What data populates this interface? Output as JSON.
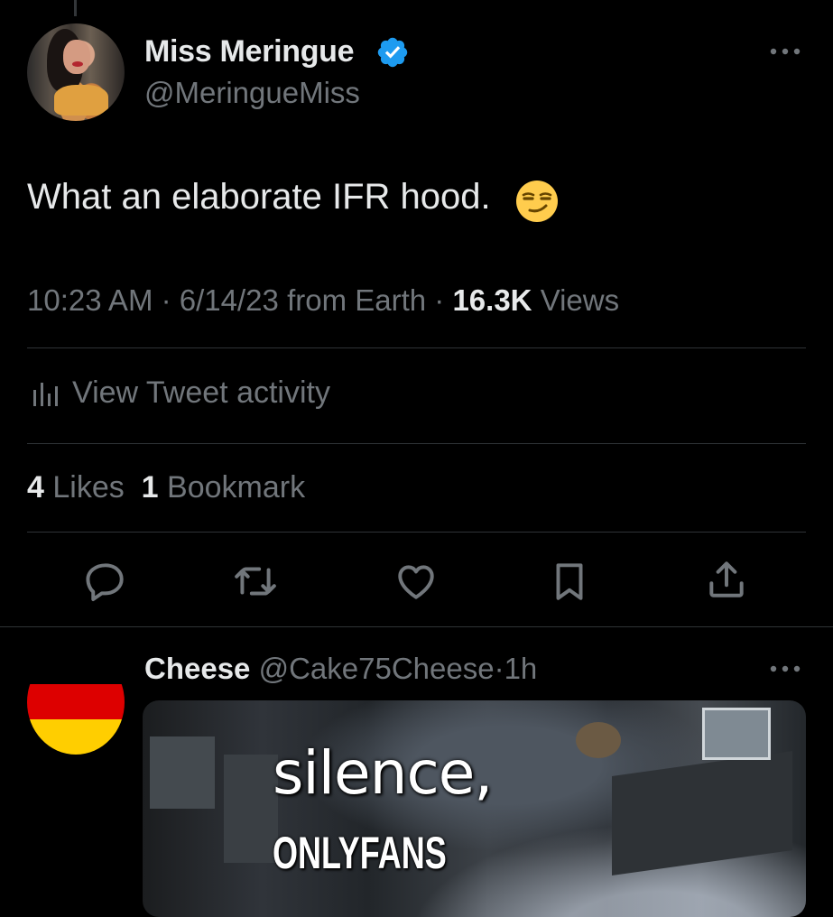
{
  "main_tweet": {
    "author": {
      "display_name": "Miss Meringue",
      "handle": "@MeringueMiss",
      "verified": true
    },
    "text": "What an elaborate IFR hood.",
    "emoji": "smirking-face",
    "meta": {
      "time": "10:23 AM",
      "date": "6/14/23",
      "source": "from Earth",
      "views_count": "16.3K",
      "views_label": "Views",
      "separator": "·"
    },
    "activity_label": "View Tweet activity",
    "stats": {
      "likes_count": "4",
      "likes_label": "Likes",
      "bookmarks_count": "1",
      "bookmarks_label": "Bookmark"
    },
    "actions": [
      "reply-icon",
      "retweet-icon",
      "like-icon",
      "bookmark-icon",
      "share-icon"
    ]
  },
  "reply_tweet": {
    "author": {
      "display_name": "Cheese",
      "handle": "@Cake75Cheese",
      "separator": "·",
      "time": "1h"
    },
    "media_caption": {
      "line1": "silence,",
      "line2": "ONLYFANS"
    }
  },
  "colors": {
    "background": "#000000",
    "text_primary": "#e7e9ea",
    "text_secondary": "#71767b",
    "divider": "#2f3336",
    "verified_blue": "#1d9bf0"
  }
}
